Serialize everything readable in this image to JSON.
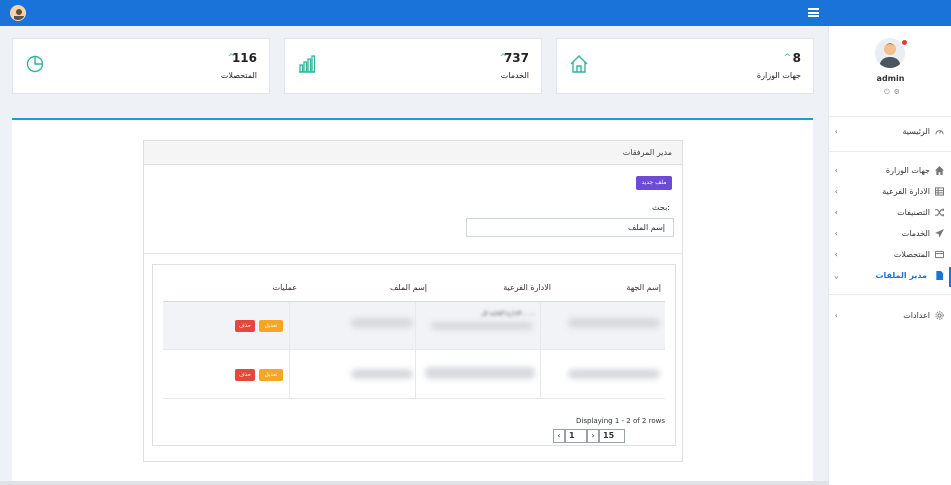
{
  "sidebar": {
    "username": "admin",
    "items": [
      {
        "label": "الرئيسية",
        "icon": "dashboard-icon"
      },
      {
        "label": "جهات الوزارة",
        "icon": "home-icon"
      },
      {
        "label": "الادارة الفرعية",
        "icon": "list-icon"
      },
      {
        "label": "التصنيفات",
        "icon": "shuffle-icon"
      },
      {
        "label": "الخدمات",
        "icon": "paper-plane-icon"
      },
      {
        "label": "المتحصلات",
        "icon": "credit-card-icon"
      },
      {
        "label": "مدير الملفات",
        "icon": "file-icon"
      },
      {
        "label": "اعدادات",
        "icon": "gear-icon"
      }
    ]
  },
  "stats": [
    {
      "value": "8",
      "caption": "جهات الوزارة",
      "icon": "home-icon"
    },
    {
      "value": "737",
      "caption": "الخدمات",
      "icon": "bar-chart-icon"
    },
    {
      "value": "116",
      "caption": "المتحصلات",
      "icon": "pie-chart-icon"
    }
  ],
  "attachments": {
    "title": "مدير المرفقات",
    "new_file_label": "ملف جديد",
    "search_label": "بحث:",
    "search_value": "إسم الملف",
    "columns": [
      "إسم الجهة",
      "الادارة الفرعية",
      "إسم الملف",
      "عمليات"
    ],
    "rows": [
      {
        "sub_dept": "الادارة العامة لل .. ...",
        "edit_label": "تعديل",
        "delete_label": "حذف"
      },
      {
        "sub_dept": "",
        "edit_label": "تعديل",
        "delete_label": "حذف"
      }
    ],
    "pagination": {
      "info": "Displaying 1 - 2 of 2 rows",
      "page": "1",
      "page_size": "15"
    }
  },
  "colors": {
    "topbar": "#1a73d9",
    "accent_teal": "#2fb59a",
    "new_button": "#6c4bd8",
    "edit_button": "#f5a623",
    "delete_button": "#e8463b"
  }
}
